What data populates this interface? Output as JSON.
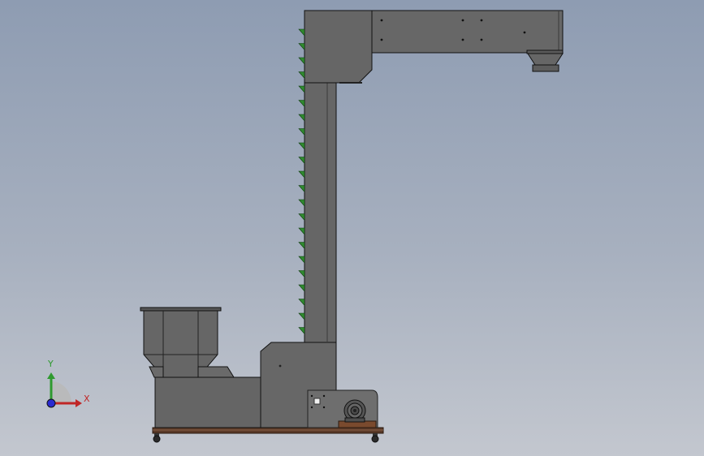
{
  "scene": {
    "model": "z-type-bucket-elevator",
    "background_top": "#8e9cb2",
    "background_bottom": "#c3c7cf",
    "body_color": "#646464",
    "bucket_color": "#2f8a2f",
    "frame_color": "#5a3a28"
  },
  "triad": {
    "x_label": "X",
    "y_label": "Y",
    "x_color": "#c02626",
    "y_color": "#2f9a2f",
    "z_color": "#2a2ad0"
  }
}
